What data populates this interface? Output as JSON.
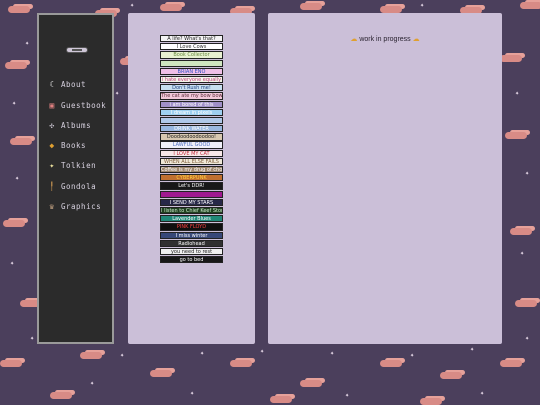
{
  "sidebar": {
    "items": [
      {
        "label": "About",
        "icon": "moon-icon",
        "glyph": "☾",
        "color": "#f2f2f2"
      },
      {
        "label": "Guestbook",
        "icon": "book-icon",
        "glyph": "▣",
        "color": "#e08080"
      },
      {
        "label": "Albums",
        "icon": "cd-icon",
        "glyph": "✣",
        "color": "#d8d2e0"
      },
      {
        "label": "Books",
        "icon": "books-icon",
        "glyph": "◆",
        "color": "#e0a030"
      },
      {
        "label": "Tolkien",
        "icon": "sparkle-icon",
        "glyph": "✦",
        "color": "#f0e6a0"
      },
      {
        "label": "Gondola",
        "icon": "candle-icon",
        "glyph": "╿",
        "color": "#c09050"
      },
      {
        "label": "Graphics",
        "icon": "cat-icon",
        "glyph": "♛",
        "color": "#c0a080"
      }
    ]
  },
  "main": {
    "wip_text": "work in progress",
    "wip_icon_glyph": "☁"
  },
  "blinkies": [
    {
      "text": "A life? What's that?",
      "bg": "#f4f4f4",
      "fg": "#222222"
    },
    {
      "text": "I Love Cows",
      "bg": "#ffffff",
      "fg": "#333333"
    },
    {
      "text": "Book Collector",
      "bg": "#e8f0d0",
      "fg": "#6a8a40"
    },
    {
      "text": "",
      "bg": "#cfe6c0",
      "fg": "#446633"
    },
    {
      "text": "BRIAN ENO",
      "bg": "#f0c0e8",
      "fg": "#3050c0"
    },
    {
      "text": "i hate everyone equally",
      "bg": "#f4f4e8",
      "fg": "#c04080"
    },
    {
      "text": "Don't Rush me!",
      "bg": "#c8e0f0",
      "fg": "#204080"
    },
    {
      "text": "The cat ate my bow bow",
      "bg": "#f0c8d8",
      "fg": "#603040"
    },
    {
      "text": "i am bored of this",
      "bg": "#a090c8",
      "fg": "#ffffff"
    },
    {
      "text": "I dream in pixels",
      "bg": "#9fd0f0",
      "fg": "#ffffff"
    },
    {
      "text": "",
      "bg": "#b0c8e8",
      "fg": "#ffffff"
    },
    {
      "text": "DRINK WATER",
      "bg": "#9ab8e0",
      "fg": "#ffffff"
    },
    {
      "text": "Doodoodoodoodoo!",
      "bg": "#d8c8b0",
      "fg": "#202020"
    },
    {
      "text": "LAWFUL GOOD",
      "bg": "#f0f0f8",
      "fg": "#5070c0"
    },
    {
      "text": "I LOVE MY CAT",
      "bg": "#f8e8e8",
      "fg": "#c03040"
    },
    {
      "text": "WHEN ALL ELSE FAILS",
      "bg": "#f0e8d8",
      "fg": "#806040"
    },
    {
      "text": "Coffee is my drug of choice",
      "bg": "#a08870",
      "fg": "#ffffff"
    },
    {
      "text": "CYBERPUNK",
      "bg": "#c07030",
      "fg": "#ffd040"
    },
    {
      "text": "Let's DDR!",
      "bg": "#181818",
      "fg": "#ffffff"
    },
    {
      "text": "",
      "bg": "#a01890",
      "fg": "#ffffff"
    },
    {
      "text": "I SEND MY STARS",
      "bg": "#282848",
      "fg": "#ffffff"
    },
    {
      "text": "I listen to Chief Keef Stories",
      "bg": "#204020",
      "fg": "#d0f0d0"
    },
    {
      "text": "Lavender Blues",
      "bg": "#208878",
      "fg": "#ffffff"
    },
    {
      "text": "PINK FLOYD",
      "bg": "#101010",
      "fg": "#ff4040"
    },
    {
      "text": "I miss winter",
      "bg": "#384878",
      "fg": "#ffffff"
    },
    {
      "text": "Radiohead",
      "bg": "#303030",
      "fg": "#ffffff"
    },
    {
      "text": "you need to rest",
      "bg": "#f0f0f0",
      "fg": "#202020"
    },
    {
      "text": "go to bed",
      "bg": "#181818",
      "fg": "#ffffff"
    }
  ]
}
